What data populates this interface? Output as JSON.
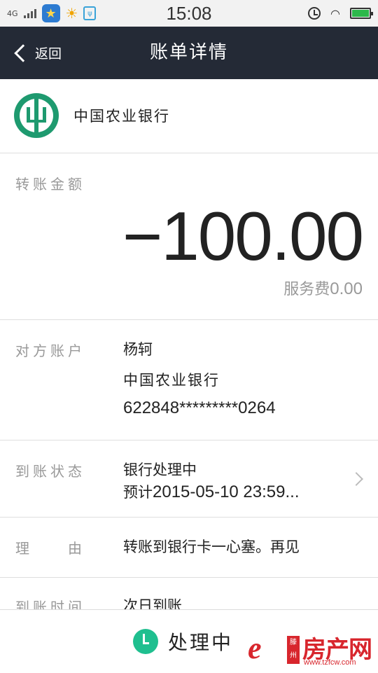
{
  "status_bar": {
    "network": "4G",
    "time": "15:08",
    "battery_level": 1.0,
    "colors": {
      "battery": "#2db84b",
      "app_badge": "#2d7bd1"
    }
  },
  "nav": {
    "back_label": "返回",
    "title": "账单详情"
  },
  "bank": {
    "name": "中国农业银行",
    "logo_color": "#1e9a6f"
  },
  "amount": {
    "label": "转账金额",
    "value": "−100.00",
    "fee_label": "服务费",
    "fee_value": "0.00"
  },
  "recipient": {
    "label": "对方账户",
    "name": "杨轲",
    "bank": "中国农业银行",
    "card": "622848*********0264"
  },
  "arrival_status": {
    "label": "到账状态",
    "status": "银行处理中",
    "eta_prefix": "预计",
    "eta": "2015-05-10 23:59..."
  },
  "reason": {
    "label": "理　　由",
    "value": "转账到银行卡一心塞。再见"
  },
  "arrival_time": {
    "label": "到账时间",
    "value": "次日到账"
  },
  "bottom": {
    "status_text": "处理中",
    "accent": "#1fbf8f"
  },
  "watermark": {
    "box_text": "滕州",
    "brand": "房产网",
    "url": "www.tzfcw.com"
  }
}
